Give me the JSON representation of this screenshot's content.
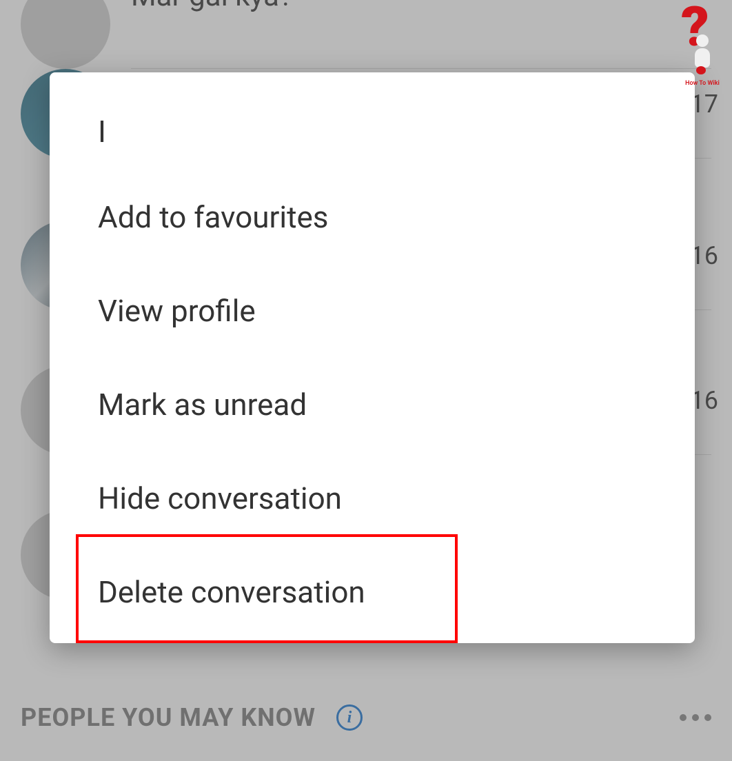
{
  "background": {
    "message_preview": "Mar gai kya?",
    "timestamps": {
      "row2": "17",
      "row3": "16",
      "row4": "16"
    },
    "section_title": "PEOPLE YOU MAY KNOW"
  },
  "modal": {
    "header_char": "I",
    "items": [
      "Add to favourites",
      "View profile",
      "Mark as unread",
      "Hide conversation",
      "Delete conversation"
    ]
  },
  "watermark": {
    "text": "How To Wiki"
  }
}
